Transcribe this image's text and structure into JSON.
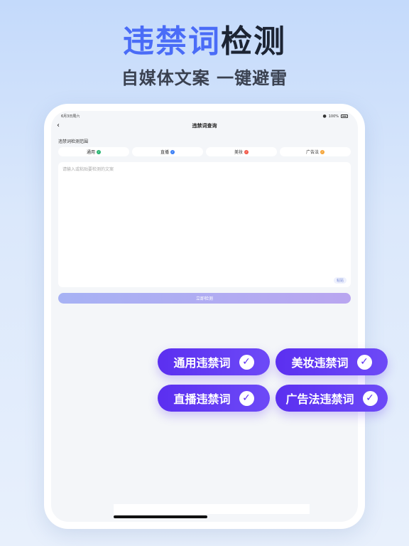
{
  "headline": {
    "part1": "违禁词",
    "part2": "检测"
  },
  "subheadline": "自媒体文案  一键避雷",
  "device": {
    "status": {
      "time": "6月3日周六",
      "battery": "100%"
    },
    "nav": {
      "title": "违禁词查询",
      "back_icon": "chevron-left-icon"
    },
    "range_label": "违禁词检测范围",
    "chips": [
      {
        "label": "通用",
        "check_color": "#2bb673"
      },
      {
        "label": "直播",
        "check_color": "#3b7ff5"
      },
      {
        "label": "美妆",
        "check_color": "#f25b4b"
      },
      {
        "label": "广告法",
        "check_color": "#f5a63b"
      }
    ],
    "input": {
      "placeholder": "请输入或粘贴要检测的文案",
      "paste_label": "粘贴"
    },
    "detect_button": "立即检测"
  },
  "pills": [
    {
      "label": "通用违禁词"
    },
    {
      "label": "美妆违禁词"
    },
    {
      "label": "直播违禁词"
    },
    {
      "label": "广告法违禁词"
    }
  ],
  "colors": {
    "accent_blue": "#4a6cf7",
    "pill_purple": "#5b2ff0"
  }
}
